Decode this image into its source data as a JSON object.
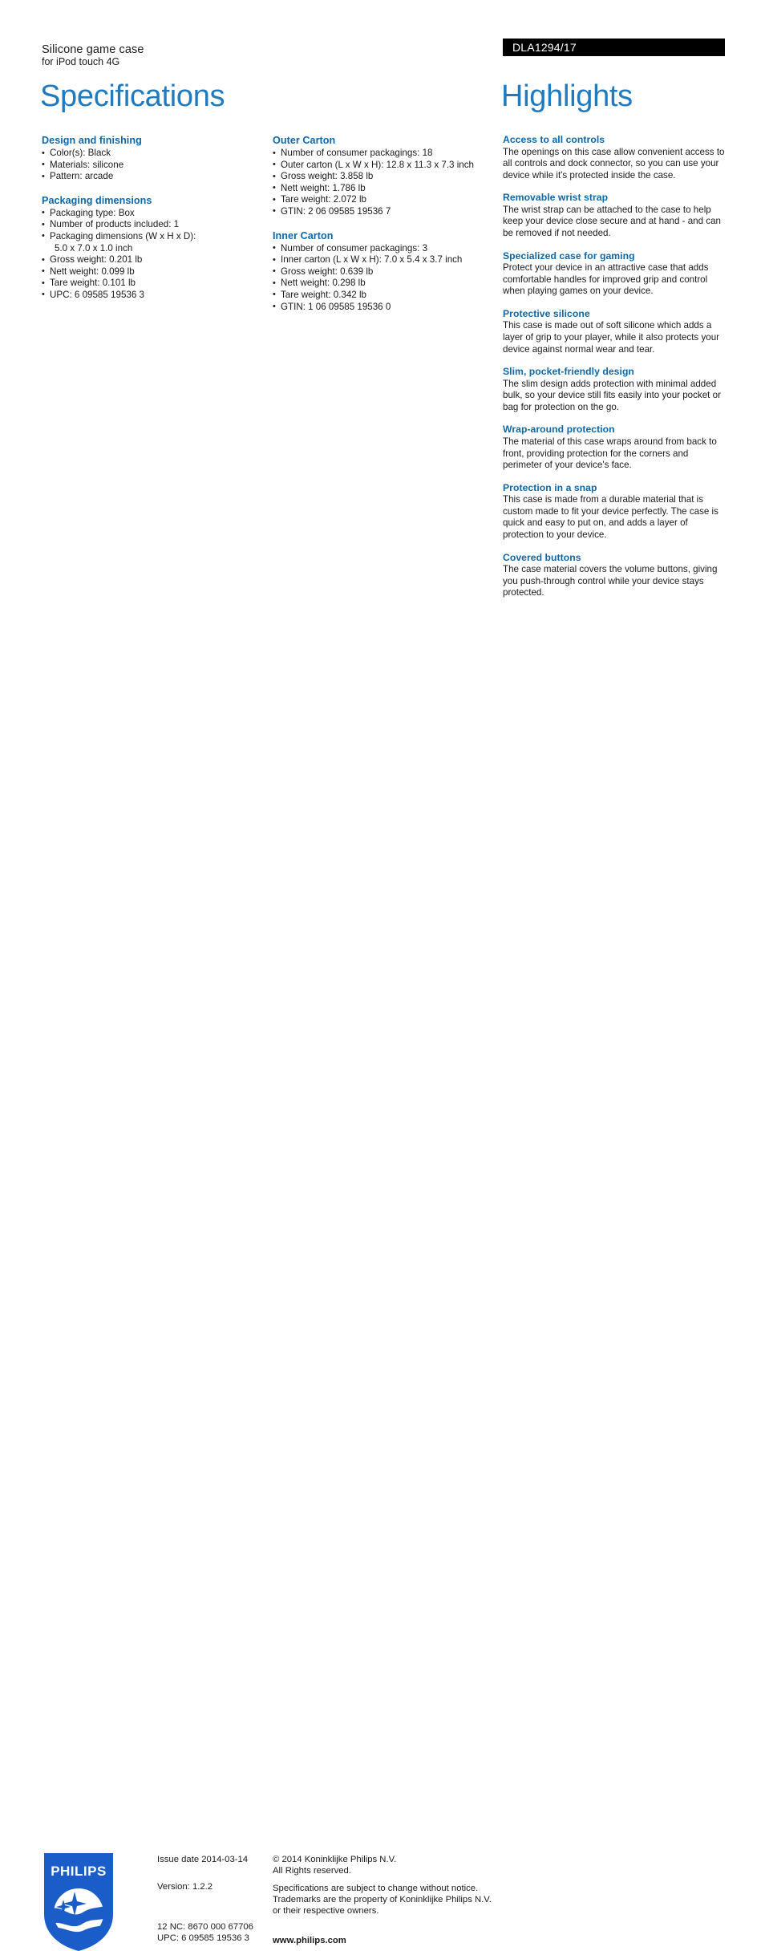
{
  "header": {
    "product_name": "Silicone game case",
    "product_subtitle": "for iPod touch 4G",
    "product_code": "DLA1294/17",
    "title_left": "Specifications",
    "title_right": "Highlights"
  },
  "specifications": {
    "column_1": [
      {
        "title": "Design and finishing",
        "items": [
          {
            "text": "Color(s): Black",
            "cont": false
          },
          {
            "text": "Materials: silicone",
            "cont": false
          },
          {
            "text": "Pattern: arcade",
            "cont": false
          }
        ]
      },
      {
        "title": "Packaging dimensions",
        "items": [
          {
            "text": "Packaging type: Box",
            "cont": false
          },
          {
            "text": "Number of products included: 1",
            "cont": false
          },
          {
            "text": "Packaging dimensions (W x H x D):",
            "cont": false
          },
          {
            "text": "5.0 x 7.0 x 1.0 inch",
            "cont": true
          },
          {
            "text": "Gross weight: 0.201 lb",
            "cont": false
          },
          {
            "text": "Nett weight: 0.099 lb",
            "cont": false
          },
          {
            "text": "Tare weight: 0.101 lb",
            "cont": false
          },
          {
            "text": "UPC: 6 09585 19536 3",
            "cont": false
          }
        ]
      }
    ],
    "column_2": [
      {
        "title": "Outer Carton",
        "items": [
          {
            "text": "Number of consumer packagings: 18",
            "cont": false
          },
          {
            "text": "Outer carton (L x W x H): 12.8 x 11.3 x 7.3 inch",
            "cont": false
          },
          {
            "text": "Gross weight: 3.858 lb",
            "cont": false
          },
          {
            "text": "Nett weight: 1.786 lb",
            "cont": false
          },
          {
            "text": "Tare weight: 2.072 lb",
            "cont": false
          },
          {
            "text": "GTIN: 2 06 09585 19536 7",
            "cont": false
          }
        ]
      },
      {
        "title": "Inner Carton",
        "items": [
          {
            "text": "Number of consumer packagings: 3",
            "cont": false
          },
          {
            "text": "Inner carton (L x W x H): 7.0 x 5.4 x 3.7 inch",
            "cont": false
          },
          {
            "text": "Gross weight: 0.639 lb",
            "cont": false
          },
          {
            "text": "Nett weight: 0.298 lb",
            "cont": false
          },
          {
            "text": "Tare weight: 0.342 lb",
            "cont": false
          },
          {
            "text": "GTIN: 1 06 09585 19536 0",
            "cont": false
          }
        ]
      }
    ]
  },
  "highlights": [
    {
      "title": "Access to all controls",
      "body": "The openings on this case allow convenient access to all controls and dock connector, so you can use your device while it's protected inside the case."
    },
    {
      "title": "Removable wrist strap",
      "body": "The wrist strap can be attached to the case to help keep your device close secure and at hand - and can be removed if not needed."
    },
    {
      "title": "Specialized case for gaming",
      "body": "Protect your device in an attractive case that adds comfortable handles for improved grip and control when playing games on your device."
    },
    {
      "title": "Protective silicone",
      "body": "This case is made out of soft silicone which adds a layer of grip to your player, while it also protects your device against normal wear and tear."
    },
    {
      "title": "Slim, pocket-friendly design",
      "body": "The slim design adds protection with minimal added bulk, so your device still fits easily into your pocket or bag for protection on the go."
    },
    {
      "title": "Wrap-around protection",
      "body": "The material of this case wraps around from back to front, providing protection for the corners and perimeter of your device's face."
    },
    {
      "title": "Protection in a snap",
      "body": "This case is made from a durable material that is custom made to fit your device perfectly. The case is quick and easy to put on, and adds a layer of protection to your device."
    },
    {
      "title": "Covered buttons",
      "body": "The case material covers the volume buttons, giving you push-through control while your device stays protected."
    }
  ],
  "footer": {
    "logo_wordmark": "PHILIPS",
    "issue_date": "Issue date 2014-03-14",
    "version": "Version: 1.2.2",
    "nc_code": "12 NC: 8670 000 67706",
    "upc": "UPC: 6 09585 19536 3",
    "copyright_line1": "© 2014 Koninklijke Philips N.V.",
    "copyright_line2": "All Rights reserved.",
    "disclaimer_line1": "Specifications are subject to change without notice.",
    "disclaimer_line2": "Trademarks are the property of Koninklijke Philips N.V.",
    "disclaimer_line3": "or their respective owners.",
    "website": "www.philips.com"
  },
  "colors": {
    "heading_blue": "#0d67a8",
    "title_blue": "#1f7ac0",
    "logo_blue": "#1a5cc8",
    "banner_black": "#000000",
    "body_text": "#1a1a1a"
  }
}
